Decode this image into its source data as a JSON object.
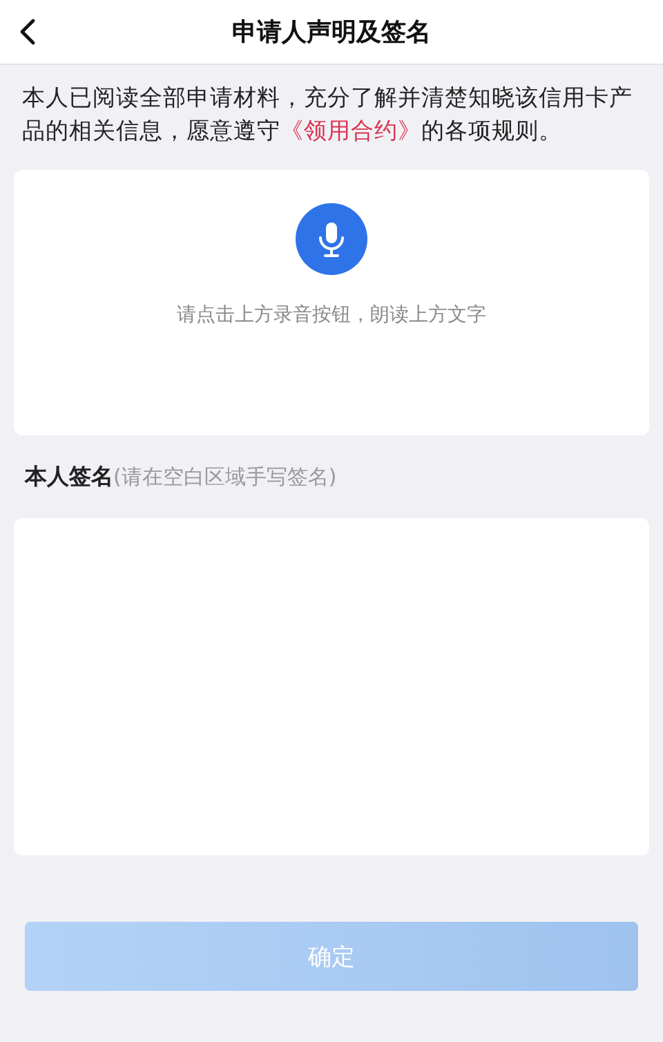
{
  "header": {
    "title": "申请人声明及签名"
  },
  "declaration": {
    "before": "本人已阅读全部申请材料，充分了解并清楚知晓该信用卡产品的相关信息，愿意遵守",
    "link": "《领用合约》",
    "after": "的各项规则。"
  },
  "recording": {
    "hint": "请点击上方录音按钮，朗读上方文字"
  },
  "signature": {
    "label": "本人签名",
    "hint": "(请在空白区域手写签名)"
  },
  "confirm_button": {
    "label": "确定",
    "disabled": true
  }
}
